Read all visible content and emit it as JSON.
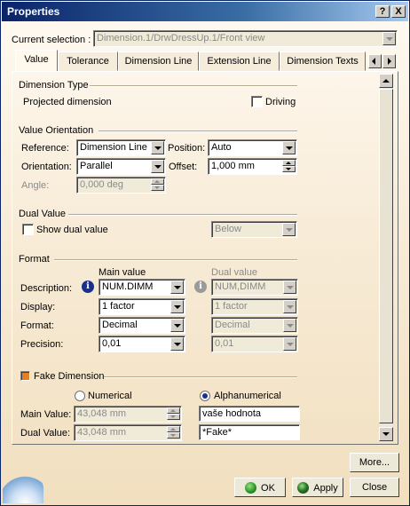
{
  "window": {
    "title": "Properties",
    "help_label": "?",
    "close_label": "X"
  },
  "selection": {
    "label": "Current selection :",
    "value": "Dimension.1/DrwDressUp.1/Front view"
  },
  "tabs": [
    {
      "label": "Value",
      "active": true
    },
    {
      "label": "Tolerance"
    },
    {
      "label": "Dimension Line"
    },
    {
      "label": "Extension Line"
    },
    {
      "label": "Dimension Texts"
    }
  ],
  "dimension_type": {
    "heading": "Dimension Type",
    "value": "Projected dimension",
    "driving_label": "Driving",
    "driving_checked": false
  },
  "value_orientation": {
    "heading": "Value Orientation",
    "reference_label": "Reference:",
    "reference_value": "Dimension Line",
    "position_label": "Position:",
    "position_value": "Auto",
    "orientation_label": "Orientation:",
    "orientation_value": "Parallel",
    "offset_label": "Offset:",
    "offset_value": "1,000 mm",
    "angle_label": "Angle:",
    "angle_value": "0,000 deg"
  },
  "dual_value": {
    "heading": "Dual Value",
    "show_label": "Show dual value",
    "show_checked": false,
    "placement_value": "Below"
  },
  "format": {
    "heading": "Format",
    "main_header": "Main value",
    "dual_header": "Dual value",
    "description_label": "Description:",
    "main_description": "NUM.DIMM",
    "dual_description": "NUM,DIMM",
    "display_label": "Display:",
    "main_display": "1 factor",
    "dual_display": "1 factor",
    "format_label": "Format:",
    "main_format": "Decimal",
    "dual_format": "Decimal",
    "precision_label": "Precision:",
    "main_precision": "0,01",
    "dual_precision": "0,01"
  },
  "fake_dimension": {
    "heading": "Fake Dimension",
    "checked": true,
    "numerical_label": "Numerical",
    "alphanumerical_label": "Alphanumerical",
    "selected_mode": "Alphanumerical",
    "main_label": "Main Value:",
    "main_numeric": "43,048 mm",
    "main_alpha": "vaše hodnota",
    "dual_label": "Dual Value:",
    "dual_numeric": "43,048 mm",
    "dual_alpha": "*Fake*"
  },
  "buttons": {
    "more": "More...",
    "ok": "OK",
    "apply": "Apply",
    "close": "Close"
  },
  "colors": {
    "title_bar": "#0a246a",
    "accent_checkbox": "#e87f1e",
    "info_icon": "#1b2f8f"
  }
}
